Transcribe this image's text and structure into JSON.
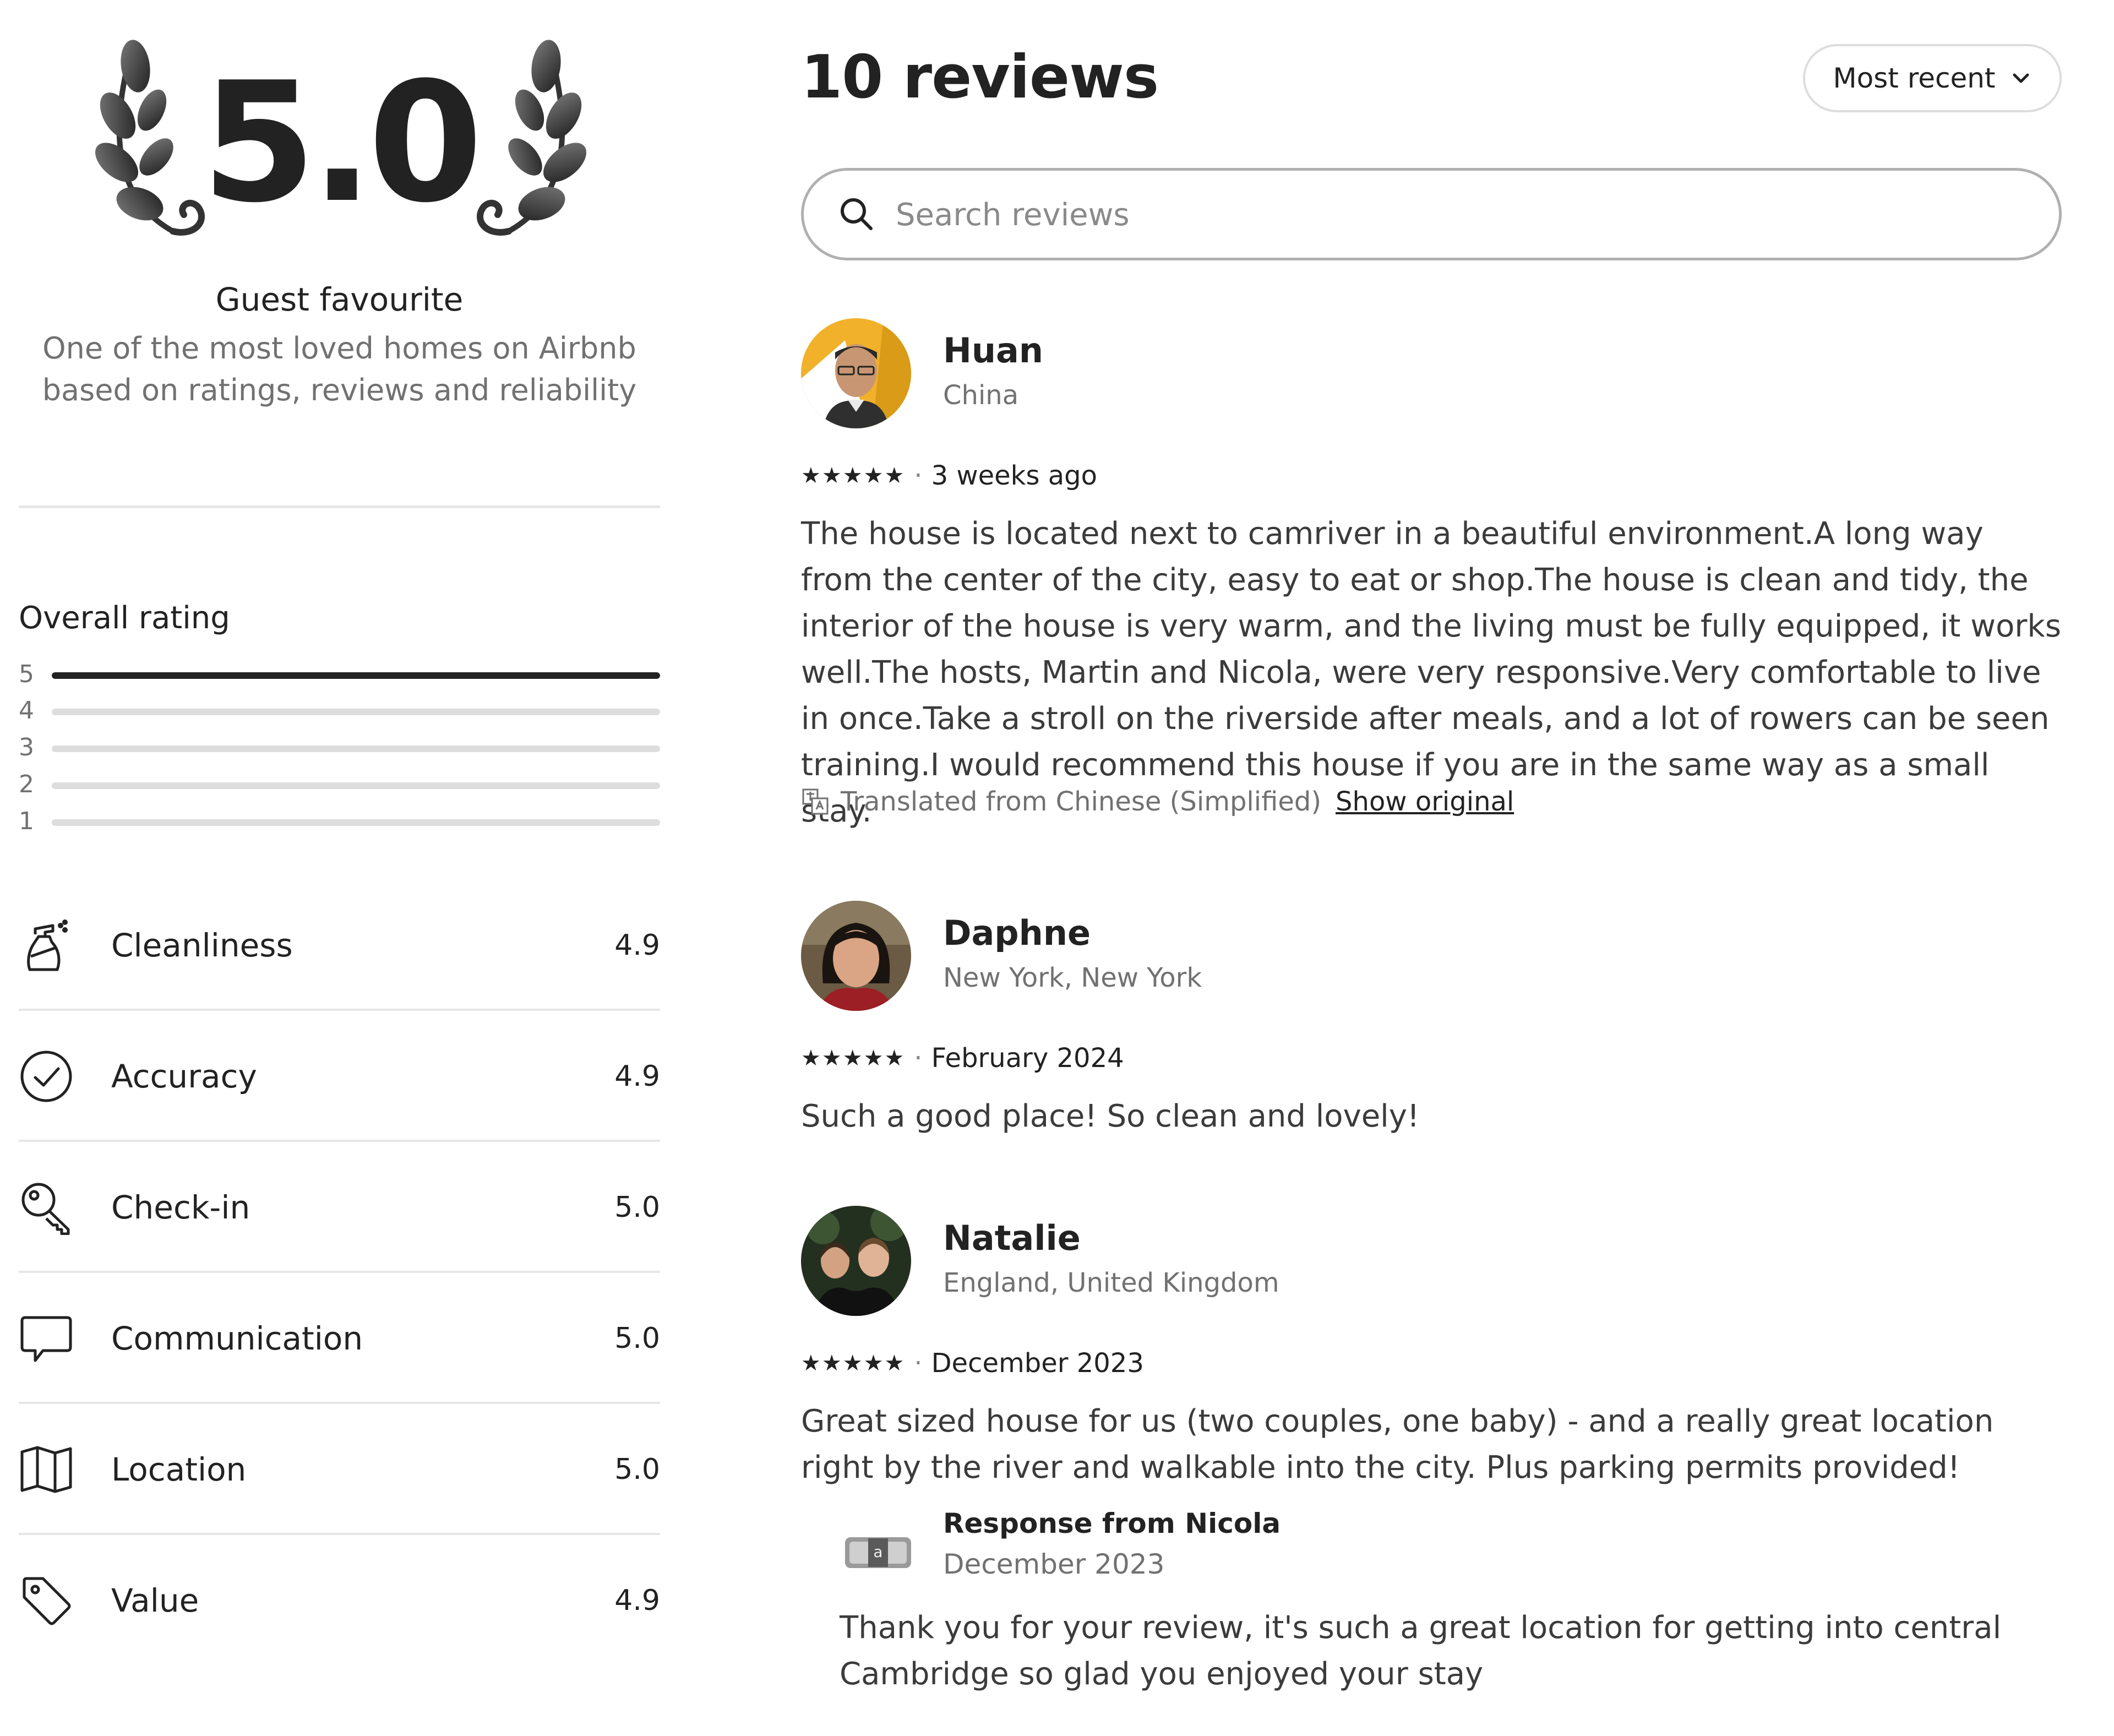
{
  "summary": {
    "score": "5.0",
    "badge_title": "Guest favourite",
    "badge_desc_line1": "One of the most loved homes on Airbnb",
    "badge_desc_line2": "based on ratings, reviews and reliability"
  },
  "overall": {
    "title": "Overall rating",
    "bars": [
      {
        "label": "5",
        "fraction": 1.0
      },
      {
        "label": "4",
        "fraction": 0.0
      },
      {
        "label": "3",
        "fraction": 0.0
      },
      {
        "label": "2",
        "fraction": 0.0
      },
      {
        "label": "1",
        "fraction": 0.0
      }
    ]
  },
  "categories": [
    {
      "label": "Cleanliness",
      "value": "4.9",
      "icon": "spray-bottle-icon"
    },
    {
      "label": "Accuracy",
      "value": "4.9",
      "icon": "check-circle-icon"
    },
    {
      "label": "Check-in",
      "value": "5.0",
      "icon": "key-icon"
    },
    {
      "label": "Communication",
      "value": "5.0",
      "icon": "chat-bubble-icon"
    },
    {
      "label": "Location",
      "value": "5.0",
      "icon": "map-icon"
    },
    {
      "label": "Value",
      "value": "4.9",
      "icon": "price-tag-icon"
    }
  ],
  "reviews_header": {
    "title": "10 reviews",
    "sort_label": "Most recent",
    "search_placeholder": "Search reviews"
  },
  "reviews": [
    {
      "name": "Huan",
      "location": "China",
      "stars": "★★★★★",
      "date": "3 weeks ago",
      "text": "The house is located next to camriver in a beautiful environment.A long way from the center of the city, easy to eat or shop.The house is clean and tidy, the interior of the house is very warm, and the living must be fully equipped, it works well.The hosts, Martin and Nicola, were very responsive.Very comfortable to live in once.Take a stroll on the riverside after meals, and a lot of rowers can be seen training.I would recommend this house if you are in the same way as a small stay.",
      "translated_note": "Translated from Chinese (Simplified)",
      "show_original": "Show original"
    },
    {
      "name": "Daphne",
      "location": "New York, New York",
      "stars": "★★★★★",
      "date": "February 2024",
      "text": "Such a good place! So clean and lovely!"
    },
    {
      "name": "Natalie",
      "location": "England, United Kingdom",
      "stars": "★★★★★",
      "date": "December 2023",
      "text": "Great sized house for us (two couples, one baby) - and a really great location right by the river and walkable into the city. Plus parking permits provided!",
      "response": {
        "from": "Response from Nicola",
        "date": "December 2023",
        "text": "Thank you for your review, it's such a great location for getting into central Cambridge so glad you enjoyed your stay"
      }
    }
  ]
}
